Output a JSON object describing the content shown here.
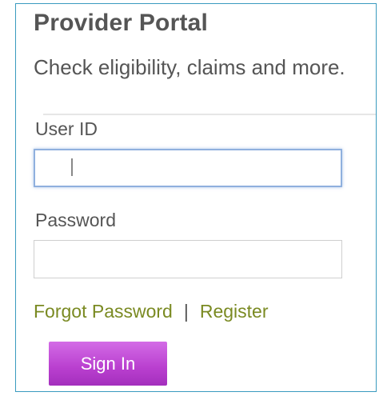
{
  "portal": {
    "title": "Provider Portal",
    "subtitle": "Check eligibility, claims and more."
  },
  "form": {
    "user_id_label": "User ID",
    "user_id_value": "",
    "password_label": "Password",
    "password_value": ""
  },
  "links": {
    "forgot_password": "Forgot Password",
    "separator": "|",
    "register": "Register"
  },
  "actions": {
    "sign_in_label": "Sign In"
  },
  "colors": {
    "border_accent": "#3a9bbf",
    "link_color": "#7a8a22",
    "button_purple": "#b93fcf",
    "focus_blue": "#8fb0de"
  }
}
